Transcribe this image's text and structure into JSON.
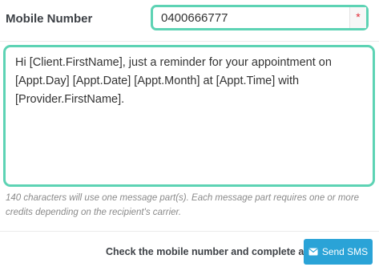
{
  "mobile": {
    "label": "Mobile Number",
    "value": "0400666777",
    "required_marker": "*"
  },
  "message": {
    "text": "Hi [Client.FirstName], just a reminder for your appointment on [Appt.Day] [Appt.Date] [Appt.Month] at [Appt.Time] with [Provider.FirstName]."
  },
  "hint": {
    "text": "140 characters will use one message part(s). Each message part requires one or more credits depending on the recipient's carrier."
  },
  "footer": {
    "status_text": "Check the mobile number and complete all fields",
    "send_label": "Send SMS",
    "send_icon": "envelope-icon"
  },
  "colors": {
    "focus_border": "#5dd3b4",
    "button_bg": "#2aa3d7",
    "required": "#e12d39"
  }
}
